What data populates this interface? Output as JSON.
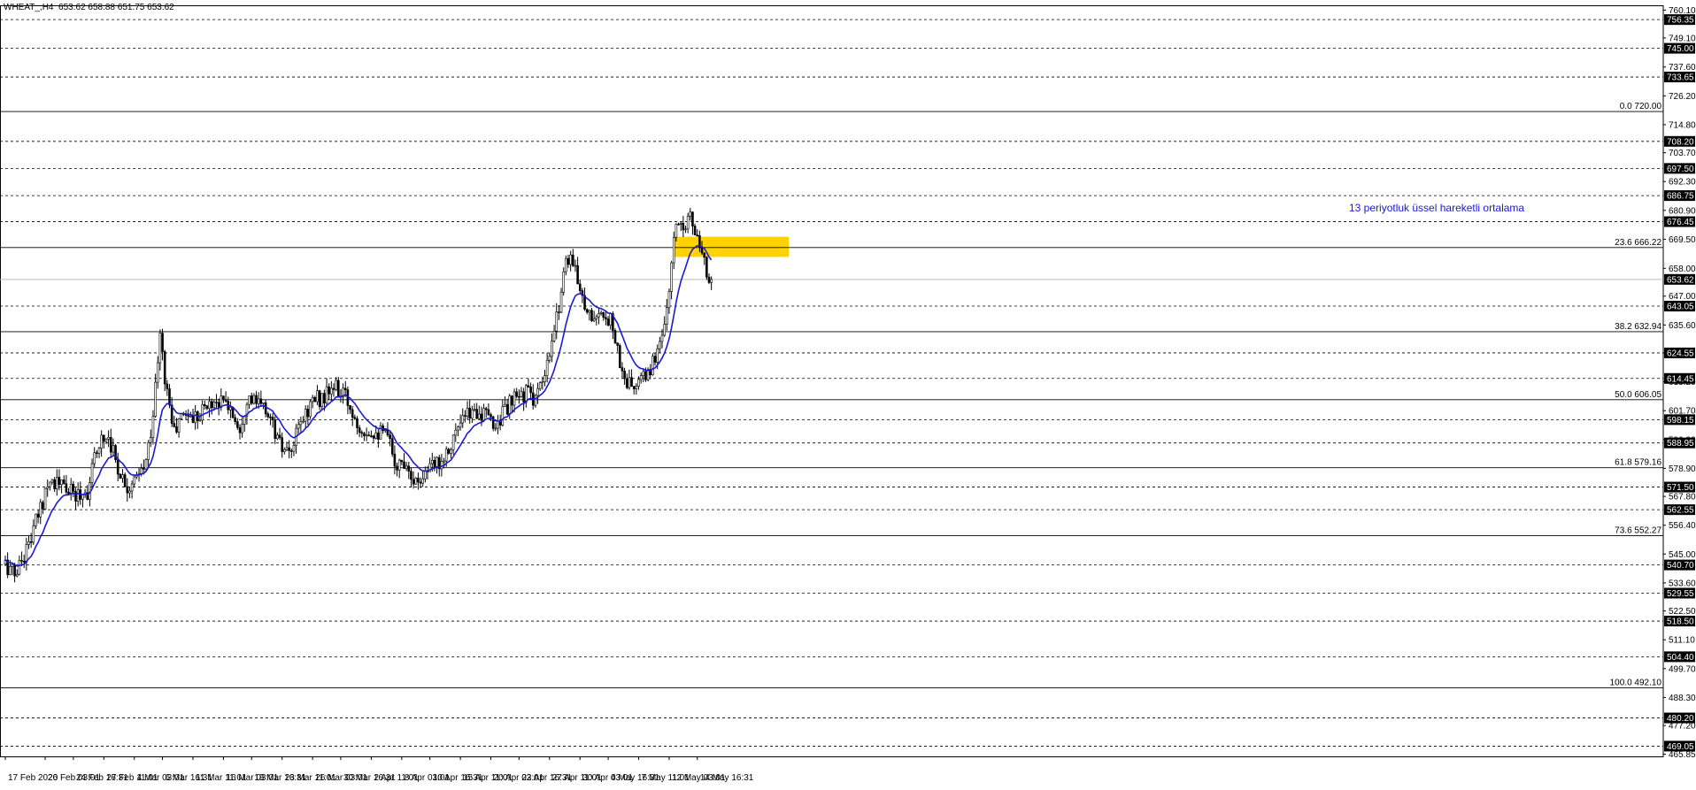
{
  "header": {
    "symbol_line": "WHEAT_,H4  653.62 658.88 651.75 653.62"
  },
  "annotation": {
    "ema_label": "13 periyotluk üssel hareketli ortalama"
  },
  "colors": {
    "candle": "#000000",
    "ema": "#1a1ad6",
    "zone": "#ffd200",
    "hline_dashed": "#000000",
    "fib": "#000000",
    "last_price_line": "#bbbbbb"
  },
  "chart_data": {
    "type": "candlestick",
    "symbol": "WHEAT_",
    "timeframe": "H4",
    "ohlc_last": {
      "open": 653.62,
      "high": 658.88,
      "low": 651.75,
      "close": 653.62
    },
    "ylim": [
      465.0,
      762.0
    ],
    "price_axis_ticks": [
      "760.10",
      "749.10",
      "737.60",
      "726.20",
      "714.80",
      "703.70",
      "692.30",
      "680.90",
      "669.50",
      "658.00",
      "647.00",
      "635.60",
      "624.55",
      "613.20",
      "601.70",
      "590.30",
      "578.90",
      "567.80",
      "556.40",
      "545.00",
      "533.60",
      "522.50",
      "511.10",
      "499.70",
      "488.30",
      "477.20",
      "465.85"
    ],
    "dashed_levels": [
      {
        "price": 756.35,
        "label": "756.35"
      },
      {
        "price": 745.0,
        "label": "745.00"
      },
      {
        "price": 733.65,
        "label": "733.65"
      },
      {
        "price": 708.2,
        "label": "708.20"
      },
      {
        "price": 697.5,
        "label": "697.50"
      },
      {
        "price": 686.75,
        "label": "686.75"
      },
      {
        "price": 676.45,
        "label": "676.45"
      },
      {
        "price": 643.05,
        "label": "643.05"
      },
      {
        "price": 624.55,
        "label": "624.55"
      },
      {
        "price": 614.45,
        "label": "614.45"
      },
      {
        "price": 598.15,
        "label": "598.15"
      },
      {
        "price": 588.95,
        "label": "588.95"
      },
      {
        "price": 571.5,
        "label": "571.50"
      },
      {
        "price": 562.55,
        "label": "562.55"
      },
      {
        "price": 540.7,
        "label": "540.70"
      },
      {
        "price": 529.55,
        "label": "529.55"
      },
      {
        "price": 518.5,
        "label": "518.50"
      },
      {
        "price": 504.4,
        "label": "504.40"
      },
      {
        "price": 480.2,
        "label": "480.20"
      },
      {
        "price": 469.05,
        "label": "469.05"
      }
    ],
    "last_price": {
      "price": 653.62,
      "label": "653.62"
    },
    "fibonacci": [
      {
        "level": "0.0",
        "price": 720.0,
        "label": "0.0 720.00"
      },
      {
        "level": "23.6",
        "price": 666.22,
        "label": "23.6 666.22"
      },
      {
        "level": "38.2",
        "price": 632.94,
        "label": "38.2 632.94"
      },
      {
        "level": "50.0",
        "price": 606.05,
        "label": "50.0 606.05"
      },
      {
        "level": "61.8",
        "price": 579.16,
        "label": "61.8 579.16"
      },
      {
        "level": "73.6",
        "price": 552.27,
        "label": "73.6 552.27"
      },
      {
        "level": "100.0",
        "price": 492.1,
        "label": "100.0 492.10"
      }
    ],
    "zone": {
      "low": 662.5,
      "high": 670.5,
      "from_bar": 285,
      "to_bar": 334
    },
    "x_labels": [
      {
        "bar": 0,
        "label": "17 Feb 2026"
      },
      {
        "bar": 17,
        "label": "20 Feb 03:01"
      },
      {
        "bar": 29,
        "label": "24 Feb 16:31"
      },
      {
        "bar": 42,
        "label": "27 Feb 11:01"
      },
      {
        "bar": 55,
        "label": "4 Mar 03:01"
      },
      {
        "bar": 67,
        "label": "6 Mar 16:31"
      },
      {
        "bar": 80,
        "label": "11 Mar 11:01"
      },
      {
        "bar": 93,
        "label": "16 Mar 03:01"
      },
      {
        "bar": 105,
        "label": "18 Mar 16:31"
      },
      {
        "bar": 118,
        "label": "23 Mar 11:01"
      },
      {
        "bar": 131,
        "label": "26 Mar 03:01"
      },
      {
        "bar": 143,
        "label": "30 Mar 16:31"
      },
      {
        "bar": 156,
        "label": "2 Apr 11:01"
      },
      {
        "bar": 169,
        "label": "8 Apr 03:01"
      },
      {
        "bar": 181,
        "label": "10 Apr 16:31"
      },
      {
        "bar": 194,
        "label": "15 Apr 11:01"
      },
      {
        "bar": 207,
        "label": "20 Apr 03:01"
      },
      {
        "bar": 219,
        "label": "22 Apr 16:31"
      },
      {
        "bar": 232,
        "label": "27 Apr 11:01"
      },
      {
        "bar": 245,
        "label": "30 Apr 03:01"
      },
      {
        "bar": 257,
        "label": "4 May 16:31"
      },
      {
        "bar": 270,
        "label": "7 May 11:01"
      },
      {
        "bar": 283,
        "label": "12 May 03:01"
      },
      {
        "bar": 295,
        "label": "14 May 16:31"
      }
    ],
    "bar_count": 372,
    "close_anchors": [
      [
        0,
        541
      ],
      [
        4,
        537
      ],
      [
        10,
        549
      ],
      [
        16,
        566
      ],
      [
        18,
        575
      ],
      [
        24,
        572
      ],
      [
        30,
        568
      ],
      [
        35,
        570
      ],
      [
        40,
        590
      ],
      [
        44,
        592
      ],
      [
        48,
        579
      ],
      [
        52,
        572
      ],
      [
        56,
        574
      ],
      [
        60,
        581
      ],
      [
        63,
        601
      ],
      [
        66,
        631
      ],
      [
        68,
        615
      ],
      [
        70,
        604
      ],
      [
        72,
        593
      ],
      [
        76,
        601
      ],
      [
        80,
        599
      ],
      [
        85,
        603
      ],
      [
        90,
        606
      ],
      [
        95,
        604
      ],
      [
        100,
        595
      ],
      [
        103,
        607
      ],
      [
        108,
        604
      ],
      [
        112,
        601
      ],
      [
        117,
        588
      ],
      [
        121,
        583
      ],
      [
        126,
        597
      ],
      [
        131,
        606
      ],
      [
        136,
        607
      ],
      [
        140,
        611
      ],
      [
        145,
        607
      ],
      [
        150,
        597
      ],
      [
        154,
        594
      ],
      [
        158,
        594
      ],
      [
        163,
        591
      ],
      [
        167,
        580
      ],
      [
        171,
        582
      ],
      [
        175,
        573
      ],
      [
        178,
        577
      ],
      [
        182,
        579
      ],
      [
        187,
        584
      ],
      [
        192,
        593
      ],
      [
        197,
        600
      ],
      [
        201,
        602
      ],
      [
        205,
        599
      ],
      [
        209,
        596
      ],
      [
        212,
        601
      ],
      [
        216,
        605
      ],
      [
        222,
        609
      ],
      [
        225,
        607
      ],
      [
        229,
        611
      ],
      [
        233,
        627
      ],
      [
        236,
        644
      ],
      [
        239,
        662
      ],
      [
        241,
        663
      ],
      [
        243,
        656
      ],
      [
        245,
        652
      ],
      [
        248,
        640
      ],
      [
        252,
        639
      ],
      [
        256,
        636
      ],
      [
        258,
        641
      ],
      [
        260,
        630
      ],
      [
        263,
        616
      ],
      [
        266,
        612
      ],
      [
        268,
        611
      ],
      [
        272,
        614
      ],
      [
        276,
        620
      ],
      [
        280,
        633
      ],
      [
        282,
        640
      ],
      [
        284,
        660
      ],
      [
        286,
        676
      ],
      [
        289,
        676
      ],
      [
        292,
        679
      ],
      [
        294,
        672
      ],
      [
        296,
        665
      ],
      [
        298,
        659
      ],
      [
        300,
        655
      ],
      [
        301,
        653.62
      ]
    ],
    "series": [
      {
        "type": "candlestick",
        "values": "generated from close_anchors"
      },
      {
        "type": "ema",
        "period": 13
      }
    ]
  }
}
